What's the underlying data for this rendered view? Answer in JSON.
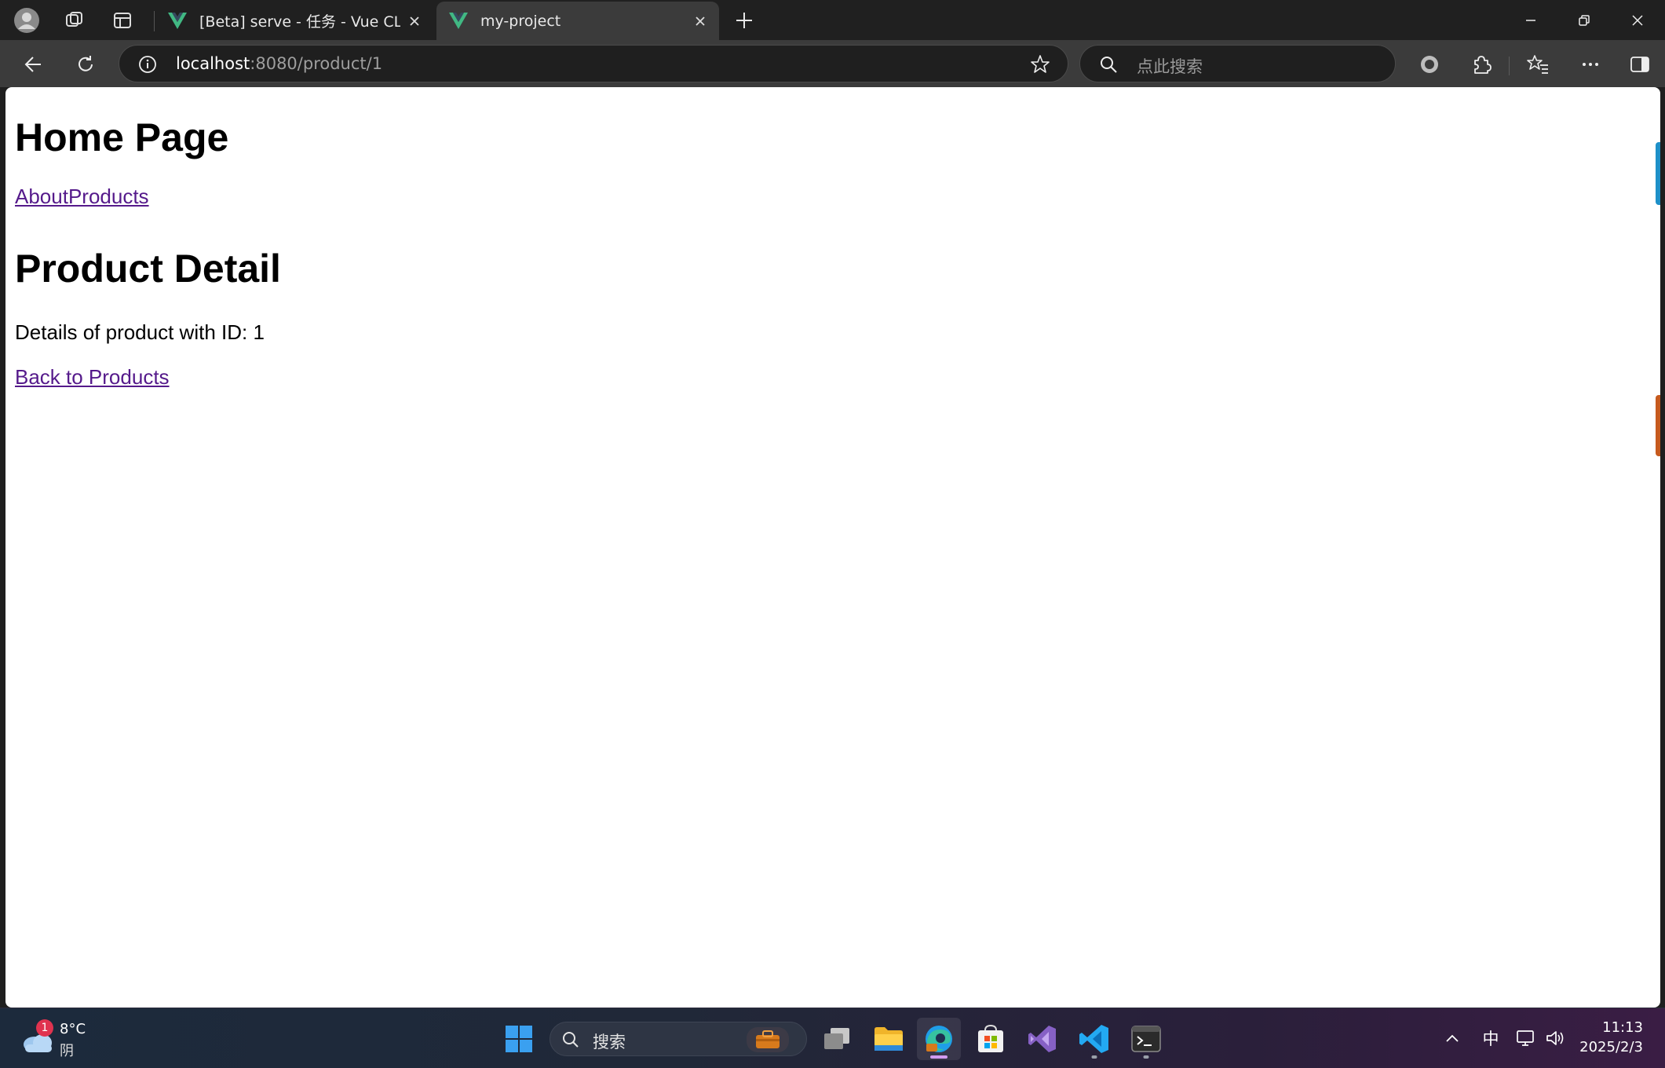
{
  "browser": {
    "tabs": [
      {
        "title": "[Beta] serve - 任务 - Vue CLI",
        "active": false
      },
      {
        "title": "my-project",
        "active": true
      }
    ],
    "address": {
      "host": "localhost",
      "rest": ":8080/product/1"
    },
    "search_placeholder": "点此搜索",
    "accent": "#41b883"
  },
  "page": {
    "heading": "Home Page",
    "nav_links": [
      "About",
      "Products"
    ],
    "detail_heading": "Product Detail",
    "description": "Details of product with ID: 1",
    "back_link": "Back to Products"
  },
  "taskbar": {
    "weather": {
      "temp": "8°C",
      "condition": "阴",
      "badge": "1"
    },
    "search_label": "搜索",
    "apps": [
      "task-view-icon",
      "file-explorer-icon",
      "edge-icon",
      "store-icon",
      "visual-studio-icon",
      "vscode-icon",
      "terminal-icon"
    ],
    "tray": {
      "ime": "中"
    },
    "clock": {
      "time": "11:13",
      "date": "2025/2/3"
    }
  }
}
